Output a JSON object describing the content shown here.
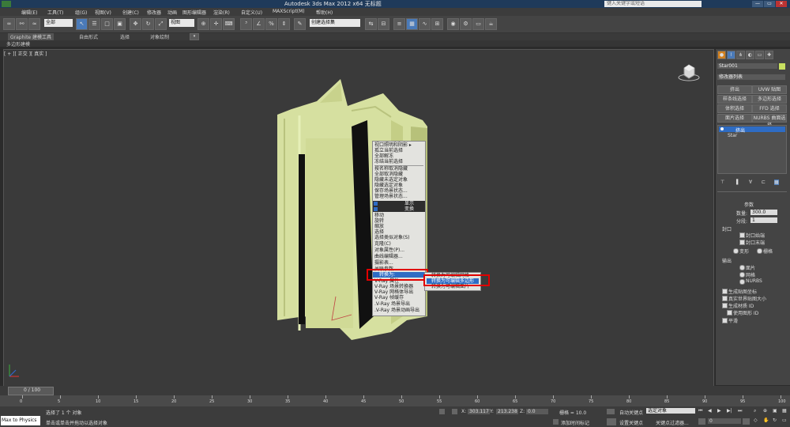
{
  "title_bar": {
    "title": "Autodesk 3ds Max  2012 x64    无标题",
    "search_placeholder": "键入关键字或短语"
  },
  "menu": [
    "编辑(E)",
    "工具(T)",
    "组(G)",
    "视图(V)",
    "创建(C)",
    "修改器",
    "动画",
    "图形编辑器",
    "渲染(R)",
    "自定义(U)",
    "MAXScript(M)",
    "帮助(H)"
  ],
  "toolbar": {
    "selection_filter": "全部",
    "ref_coord": "视图",
    "named_selection": "创建选择集"
  },
  "ribbon": {
    "tabs": [
      "Graphite 建模工具",
      "自由形式",
      "选择",
      "对象绘制"
    ],
    "sub_label": "多边形建模"
  },
  "viewport": {
    "label": "[ + ][ 正交 ][ 真实 ]"
  },
  "context_menu": {
    "items": [
      "视口照明和阴影 ▸",
      "孤立当前选择",
      "全部解冻",
      "冻结当前选择",
      "按名称取消隐藏",
      "全部取消隐藏",
      "隐藏未选定对象",
      "隐藏选定对象",
      "保存场景状态...",
      "管理场景状态...",
      "显示",
      "变换",
      "移动",
      "旋转",
      "缩放",
      "选择",
      "选择类似对象(S)",
      "克隆(C)",
      "对象属性(P)...",
      "曲线编辑器...",
      "摄影表...",
      "关联参数",
      "转换为:",
      "V-Ray 属性",
      "V-Ray 场景转换器",
      "V-Ray 网格体导出",
      "V-Ray 帧缓存",
      ".V-Ray 场景导出",
      ".V-Ray 场景动画导出"
    ]
  },
  "submenu": {
    "items": [
      "转换为可编辑网格",
      "转换为可编辑多边形",
      "转换为可编辑面片"
    ]
  },
  "command_panel": {
    "object_name": "Star001",
    "modifier_list": "修改器列表",
    "buttons": [
      "挤出",
      "UVW 贴图",
      "样条线选择",
      "多边形选择",
      "体积选择",
      "FFD 选择",
      "面片选择",
      "NURBS 曲面选择"
    ],
    "stack": [
      "挤出",
      "Star"
    ],
    "params_title": "参数",
    "amount_label": "数量:",
    "amount_value": "300.0",
    "segments_label": "分段:",
    "segments_value": "1",
    "cap_title": "封口",
    "cap_start": "封口始端",
    "cap_end": "封口末端",
    "morph": "变形",
    "grid": "栅格",
    "output_title": "输出",
    "output_options": [
      "面片",
      "网格",
      "NURBS"
    ],
    "gen_mapping": "生成贴图坐标",
    "real_world": "真实世界贴图大小",
    "gen_mat_ids": "生成材质 ID",
    "use_shape_ids": "使用图形 ID",
    "smooth": "平滑"
  },
  "timeline": {
    "frame": "0 / 100",
    "ticks": [
      "0",
      "5",
      "10",
      "15",
      "20",
      "25",
      "30",
      "35",
      "40",
      "45",
      "50",
      "55",
      "60",
      "65",
      "70",
      "75",
      "80",
      "85",
      "90",
      "95",
      "100"
    ]
  },
  "status": {
    "script_btn": "Max to Physics",
    "line1": "选择了 1 个 对象",
    "line2": "单击或单击并拖动以选择对象",
    "x_label": "X:",
    "x_value": "303.117",
    "y_label": "Y:",
    "y_value": "213.238",
    "z_label": "Z:",
    "z_value": "0.0",
    "grid": "栅格 = 10.0",
    "auto_key": "自动关键点",
    "auto_key_sel": "选定对象",
    "set_key": "设置关键点",
    "key_filters": "关键点过滤器...",
    "add_time_tag": "添加时间标记",
    "frame_value": "0"
  }
}
